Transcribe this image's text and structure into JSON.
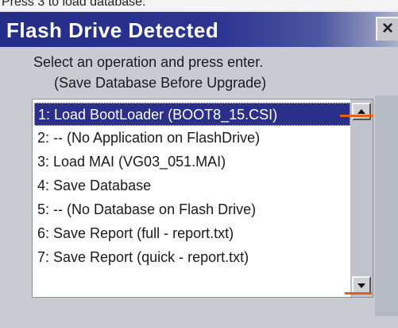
{
  "caption": "Press 3 to load database.",
  "dialog": {
    "title": "Flash Drive Detected",
    "close_label": "×",
    "instruction_line_1": "Select an operation and press enter.",
    "instruction_line_2": "(Save Database Before Upgrade)"
  },
  "list": {
    "selected_index": 0,
    "items": [
      "1: Load BootLoader (BOOT8_15.CSI)",
      "2: -- (No Application on FlashDrive)",
      "3: Load MAI (VG03_051.MAI)",
      "4: Save Database",
      "5: -- (No Database on Flash Drive)",
      "6: Save Report (full - report.txt)",
      "7: Save Report (quick - report.txt)"
    ]
  },
  "colors": {
    "titlebar": "#232c86",
    "selection": "#2a2f8c",
    "marker": "#e0601c"
  }
}
